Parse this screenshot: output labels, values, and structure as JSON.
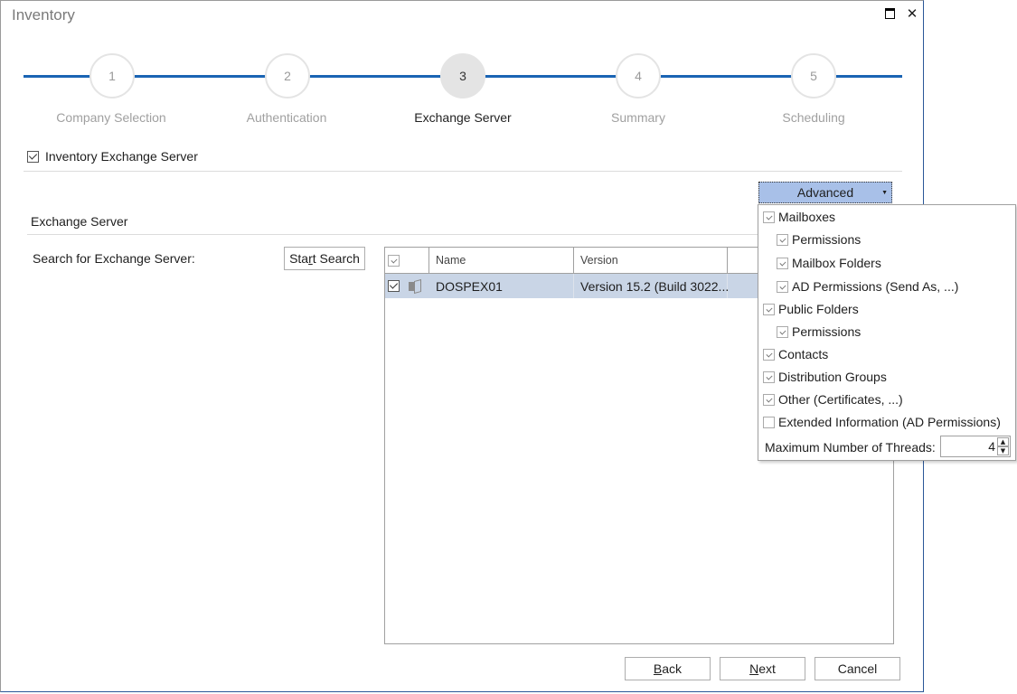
{
  "window": {
    "title": "Inventory",
    "maximize_icon": "maximize-icon",
    "close_icon": "close-icon"
  },
  "wizard": {
    "steps": [
      {
        "number": "1",
        "label": "Company Selection",
        "active": false
      },
      {
        "number": "2",
        "label": "Authentication",
        "active": false
      },
      {
        "number": "3",
        "label": "Exchange Server",
        "active": true
      },
      {
        "number": "4",
        "label": "Summary",
        "active": false
      },
      {
        "number": "5",
        "label": "Scheduling",
        "active": false
      }
    ],
    "accent_color": "#1a64b4"
  },
  "inventory_checkbox": {
    "label": "Inventory Exchange Server",
    "checked": true
  },
  "section": {
    "title": "Exchange Server"
  },
  "search": {
    "label": "Search for Exchange Server:",
    "button_pre": "Sta",
    "button_mnemonic": "r",
    "button_post": "t Search"
  },
  "grid": {
    "columns": [
      "",
      "Name",
      "Version",
      ""
    ],
    "header_checked": true,
    "rows": [
      {
        "checked": true,
        "icon": "exchange-server-icon",
        "name": "DOSPEX01",
        "version": "Version 15.2 (Build 3022..."
      }
    ],
    "selected_color": "#c9d5e6"
  },
  "advanced": {
    "label": "Advanced",
    "items": [
      {
        "label": "Mailboxes",
        "checked": true,
        "level": 0
      },
      {
        "label": "Permissions",
        "checked": true,
        "level": 1
      },
      {
        "label": "Mailbox Folders",
        "checked": true,
        "level": 1
      },
      {
        "label": "AD Permissions (Send As, ...)",
        "checked": true,
        "level": 1
      },
      {
        "label": "Public Folders",
        "checked": true,
        "level": 0
      },
      {
        "label": "Permissions",
        "checked": true,
        "level": 1
      },
      {
        "label": "Contacts",
        "checked": true,
        "level": 0
      },
      {
        "label": "Distribution Groups",
        "checked": true,
        "level": 0
      },
      {
        "label": "Other (Certificates, ...)",
        "checked": true,
        "level": 0
      },
      {
        "label": "Extended Information (AD Permissions)",
        "checked": false,
        "level": 0
      }
    ],
    "threads_label": "Maximum Number of Threads:",
    "threads_value": "4"
  },
  "footer": {
    "back": {
      "mnemonic": "B",
      "rest": "ack"
    },
    "next": {
      "mnemonic": "N",
      "rest": "ext"
    },
    "cancel": "Cancel"
  }
}
